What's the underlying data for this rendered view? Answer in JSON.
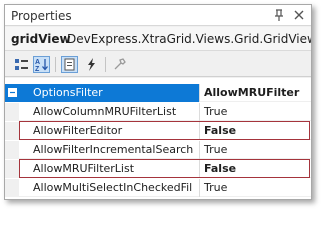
{
  "window": {
    "title": "Properties"
  },
  "object_selector": {
    "name": "gridView",
    "type": "DevExpress.XtraGrid.Views.Grid.GridView"
  },
  "toolbar": {
    "buttons": [
      "categorized-icon",
      "alphabetical-icon",
      "properties-icon",
      "events-icon",
      "property-pages-icon"
    ]
  },
  "grid": {
    "category": {
      "name": "OptionsFilter",
      "value": "AllowMRUFilter"
    },
    "rows": [
      {
        "name": "AllowColumnMRUFilterList",
        "value": "True"
      },
      {
        "name": "AllowFilterEditor",
        "value": "False"
      },
      {
        "name": "AllowFilterIncrementalSearch",
        "value": "True"
      },
      {
        "name": "AllowMRUFilterList",
        "value": "False"
      },
      {
        "name": "AllowMultiSelectInCheckedFil",
        "value": "True"
      }
    ]
  },
  "colors": {
    "category_header": "#0d79d6",
    "highlight_border": "#a5343c",
    "active_tool": "#c9e0f7"
  }
}
